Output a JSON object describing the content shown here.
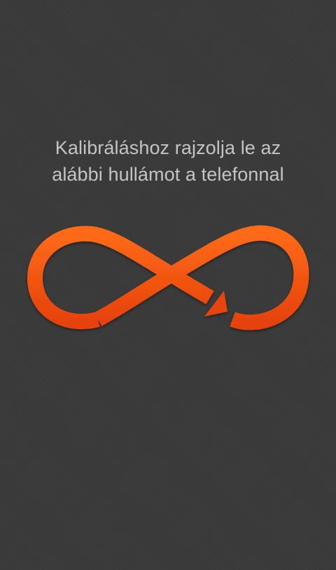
{
  "calibration": {
    "instruction_line1": "Kalibráláshoz rajzolja le az",
    "instruction_line2": "alábbi hullámot a telefonnal",
    "figure_icon": "infinity-arrow-icon",
    "accent_color": "#f05a14",
    "background_color": "#3a3a3a",
    "text_color": "#c4c4c4"
  }
}
